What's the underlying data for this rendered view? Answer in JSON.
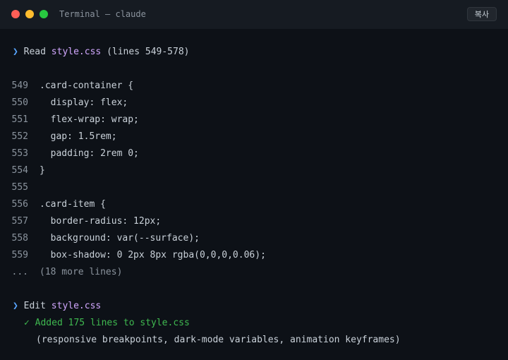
{
  "window": {
    "title": "Terminal — claude",
    "copy_label": "복사",
    "traffic_lights": {
      "close": "#ff5f57",
      "minimize": "#febc2e",
      "zoom": "#28c840"
    }
  },
  "icons": {
    "prompt": "❯",
    "check": "✓"
  },
  "read_block": {
    "verb": "Read",
    "file": "style.css",
    "range": "(lines 549-578)",
    "lines": [
      {
        "num": "549",
        "text": ".card-container {"
      },
      {
        "num": "550",
        "text": "  display: flex;"
      },
      {
        "num": "551",
        "text": "  flex-wrap: wrap;"
      },
      {
        "num": "552",
        "text": "  gap: 1.5rem;"
      },
      {
        "num": "553",
        "text": "  padding: 2rem 0;"
      },
      {
        "num": "554",
        "text": "}"
      },
      {
        "num": "555",
        "text": ""
      },
      {
        "num": "556",
        "text": ".card-item {"
      },
      {
        "num": "557",
        "text": "  border-radius: 12px;"
      },
      {
        "num": "558",
        "text": "  background: var(--surface);"
      },
      {
        "num": "559",
        "text": "  box-shadow: 0 2px 8px rgba(0,0,0,0.06);"
      }
    ],
    "more_marker": "...",
    "more_text": "(18 more lines)"
  },
  "edit_block": {
    "verb": "Edit",
    "file": "style.css",
    "result": "Added 175 lines to style.css",
    "details": "(responsive breakpoints, dark-mode variables, animation keyframes)"
  },
  "colors": {
    "background": "#0d1117",
    "titlebar": "#161b22",
    "prompt": "#58a6ff",
    "filename": "#d2a8ff",
    "success": "#3fb950",
    "muted": "#8b949e",
    "text": "#c9d1d9"
  }
}
